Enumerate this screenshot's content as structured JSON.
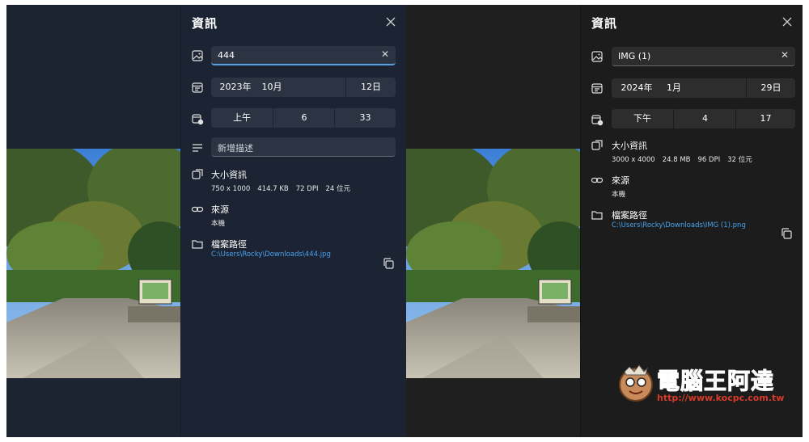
{
  "left": {
    "panel_title": "資訊",
    "name_value": "444",
    "date": {
      "year": "2023年",
      "month": "10月",
      "day": "12日"
    },
    "time": {
      "ampm": "上午",
      "hour": "6",
      "minute": "33"
    },
    "description_placeholder": "新增描述",
    "size_info": {
      "title": "大小資訊",
      "dimensions": "750 x 1000",
      "filesize": "414.7 KB",
      "dpi": "72 DPI",
      "bits": "24 位元"
    },
    "source": {
      "title": "來源",
      "value": "本機"
    },
    "path": {
      "title": "檔案路徑",
      "value": "C:\\Users\\Rocky\\Downloads\\444.jpg"
    }
  },
  "right": {
    "panel_title": "資訊",
    "name_value": "IMG (1)",
    "date": {
      "year": "2024年",
      "month": "1月",
      "day": "29日"
    },
    "time": {
      "ampm": "下午",
      "hour": "4",
      "minute": "17"
    },
    "size_info": {
      "title": "大小資訊",
      "dimensions": "3000 x 4000",
      "filesize": "24.8 MB",
      "dpi": "96 DPI",
      "bits": "32 位元"
    },
    "source": {
      "title": "來源",
      "value": "本機"
    },
    "path": {
      "title": "檔案路徑",
      "value": "C:\\Users\\Rocky\\Downloads\\IMG (1).png"
    }
  },
  "icons": {
    "close": "close-icon",
    "image": "image-icon",
    "calendar": "calendar-icon",
    "clock": "calendar-clock-icon",
    "description": "text-lines-icon",
    "size": "image-size-icon",
    "link": "link-icon",
    "folder": "folder-icon",
    "copy": "copy-icon"
  },
  "watermark": {
    "brand": "電腦王阿達",
    "url": "http://www.kocpc.com.tw"
  },
  "colors": {
    "accent": "#5aa0e0",
    "link": "#4aa3ee",
    "panel_dark_blue": "#1c2433",
    "panel_dark_gray": "#1c1c1c"
  }
}
